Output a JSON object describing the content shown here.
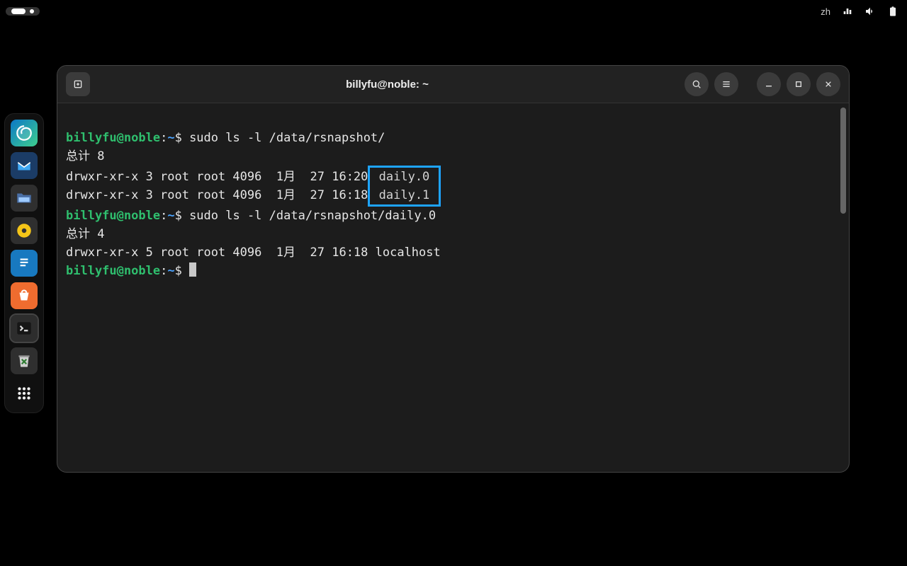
{
  "topbar": {
    "lang": "zh"
  },
  "terminal": {
    "title": "billyfu@noble: ~",
    "prompt_user": "billyfu@noble",
    "prompt_path": "~",
    "prompt_symbol": "$",
    "commands": {
      "cmd1": "sudo ls -l /data/rsnapshot/",
      "cmd2": "sudo ls -l /data/rsnapshot/daily.0"
    },
    "output1": {
      "total": "总计 8",
      "row1_pre": "drwxr-xr-x 3 root root 4096  1月  27 16:20",
      "row1_name": " daily.0 ",
      "row2_pre": "drwxr-xr-x 3 root root 4096  1月  27 16:18",
      "row2_name": " daily.1 ",
      "highlight_names": [
        "daily.0",
        "daily.1"
      ]
    },
    "output2": {
      "total": "总计 4",
      "row1": "drwxr-xr-x 5 root root 4096  1月  27 16:18 localhost"
    }
  },
  "dock": {
    "apps": [
      {
        "name": "edge",
        "label": "Microsoft Edge"
      },
      {
        "name": "thunderbird",
        "label": "Thunderbird"
      },
      {
        "name": "files",
        "label": "Files"
      },
      {
        "name": "rhythmbox",
        "label": "Rhythmbox"
      },
      {
        "name": "writer",
        "label": "LibreOffice Writer"
      },
      {
        "name": "store",
        "label": "Software"
      },
      {
        "name": "terminal",
        "label": "Terminal",
        "active": true
      },
      {
        "name": "trash",
        "label": "Trash"
      },
      {
        "name": "apps",
        "label": "Show Applications"
      }
    ]
  }
}
